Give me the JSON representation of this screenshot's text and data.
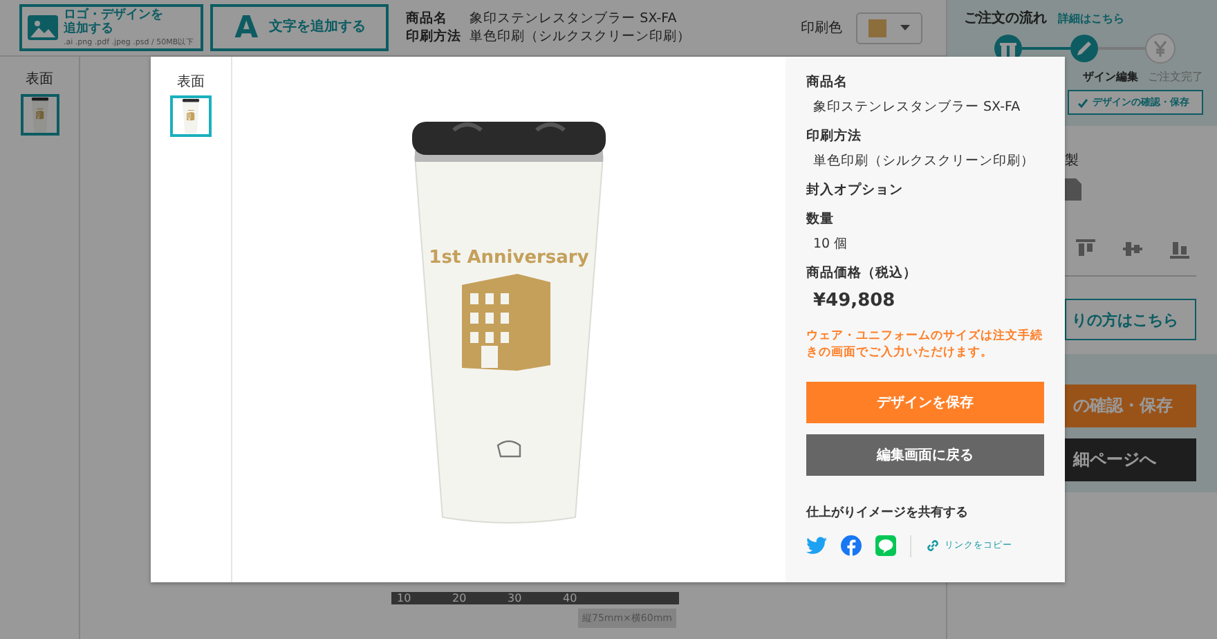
{
  "toolbar": {
    "buttons": [
      {
        "kind": "image",
        "label": "ロゴ・デザインを追加する",
        "hint": ".ai .png .pdf .jpeg .psd / 50MB以下"
      },
      {
        "kind": "letter",
        "icon": "A",
        "label": "文字を追加する"
      }
    ],
    "product": [
      {
        "label": "商品名",
        "value": "象印ステンレスタンブラー SX-FA"
      },
      {
        "label": "印刷方法",
        "value": "単色印刷（シルクスクリーン印刷）"
      }
    ],
    "print_color": {
      "label": "印刷色",
      "color": "#8c6e3c"
    }
  },
  "sides": [
    {
      "label": "表面",
      "selected": true
    }
  ],
  "canvas": {
    "ruler_labels": [
      "10",
      "20",
      "30",
      "40"
    ],
    "size_tag": "縦75mm×横60mm"
  },
  "order_flow": {
    "title": "ご注文の流れ",
    "link": "詳細はこちら",
    "steps": [
      {
        "kind": "gift",
        "done": true
      },
      {
        "kind": "edit",
        "done": true
      },
      {
        "kind": "yen",
        "done": false
      }
    ],
    "step_labels": [
      "ザイン編集",
      "ご注文完了"
    ],
    "current_note": "デザインの確認・保存"
  },
  "side_panel": {
    "copy_label": "製",
    "guide_button": "りの方はこちら",
    "actions": [
      {
        "kind": "primary",
        "label": "の確認・保存"
      },
      {
        "kind": "secondary",
        "label": "細ページへ"
      }
    ]
  },
  "modal": {
    "sides": [
      {
        "label": "表面",
        "selected": true
      }
    ],
    "print_text": "1st Anniversary",
    "details": [
      {
        "kind": "text",
        "label": "商品名",
        "value": "象印ステンレスタンブラー SX-FA"
      },
      {
        "kind": "text",
        "label": "印刷方法",
        "value": "単色印刷（シルクスクリーン印刷）"
      },
      {
        "kind": "heading",
        "label": "封入オプション"
      },
      {
        "kind": "text",
        "label": "数量",
        "value": "10 個"
      },
      {
        "kind": "price",
        "label": "商品価格（税込）",
        "value": "¥49,808"
      }
    ],
    "note": "ウェア・ユニフォームのサイズは注文手続きの画面でご入力いただけます。",
    "buttons": [
      {
        "kind": "primary",
        "label": "デザインを保存"
      },
      {
        "kind": "secondary",
        "label": "編集画面に戻る"
      }
    ],
    "share": {
      "title": "仕上がりイメージを共有する",
      "copy_link": "リンクをコピー"
    }
  }
}
